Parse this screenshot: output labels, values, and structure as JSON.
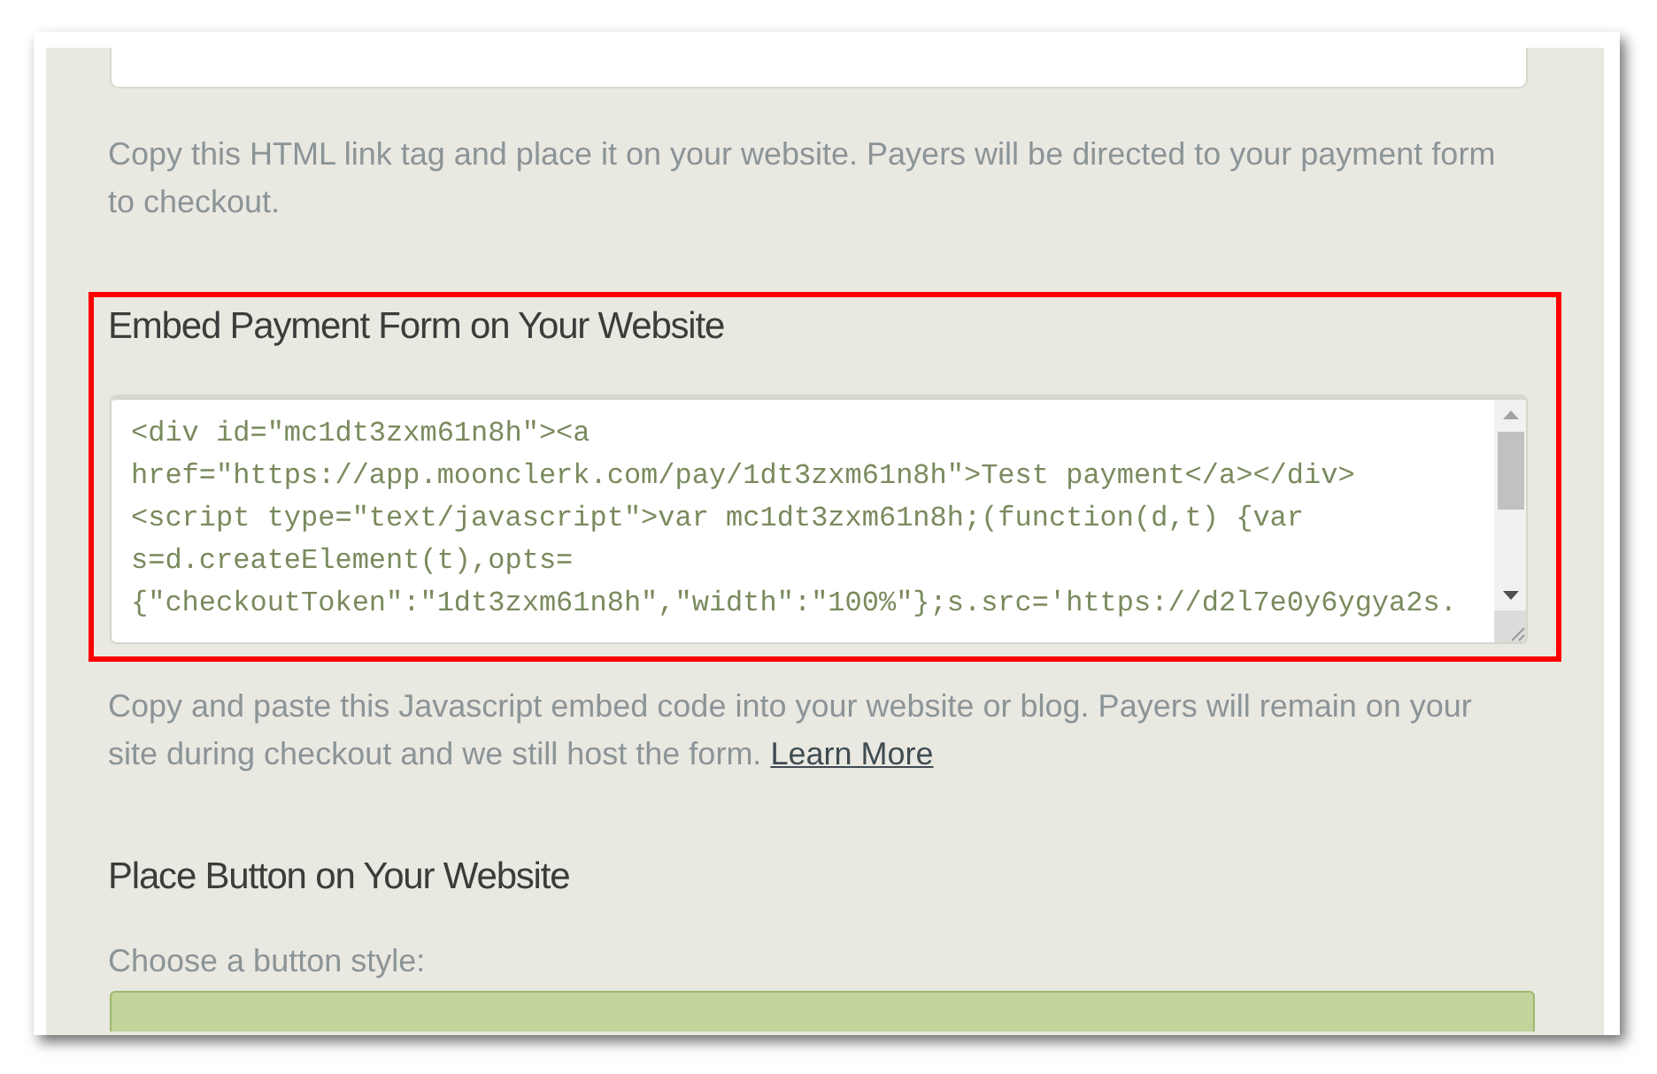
{
  "link_section": {
    "description": "Copy this HTML link tag and place it on your website. Payers will be directed to your payment form to checkout."
  },
  "embed_section": {
    "title": "Embed Payment Form on Your Website",
    "highlighted": true,
    "code_lines": [
      "<div id=\"mc1dt3zxm61n8h\"><a",
      "href=\"https://app.moonclerk.com/pay/1dt3zxm61n8h\">Test payment</a></div>",
      "<script type=\"text/javascript\">var mc1dt3zxm61n8h;(function(d,t) {var",
      "s=d.createElement(t),opts=",
      "{\"checkoutToken\":\"1dt3zxm61n8h\",\"width\":\"100%\"};s.src='https://d2l7e0y6ygya2s."
    ],
    "description": "Copy and paste this Javascript embed code into your website or blog. Payers will remain on your site during checkout and we still host the form.",
    "link": "Learn More"
  },
  "button_section": {
    "title": "Place Button on Your Website",
    "style_label": "Choose a button style:"
  }
}
